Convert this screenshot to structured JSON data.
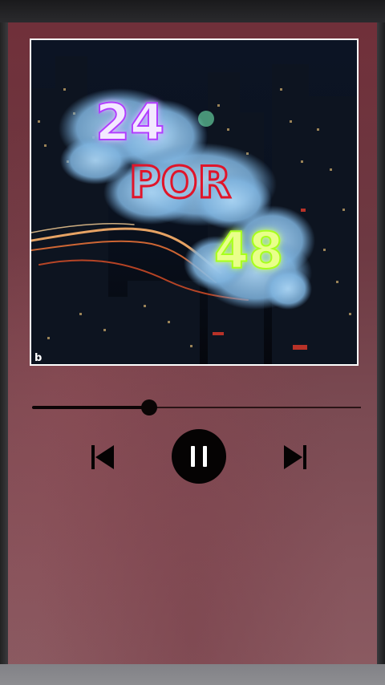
{
  "album_art": {
    "title_top": "24",
    "title_middle": "POR",
    "title_bottom": "48",
    "corner_mark": "b"
  },
  "player": {
    "progress_fraction": 0.355,
    "is_playing": true
  },
  "icons": {
    "previous": "skip-previous-icon",
    "play_pause": "pause-icon",
    "next": "skip-next-icon"
  },
  "colors": {
    "background": "#70303a",
    "accent_dark": "#050303",
    "number_24": "#f3e9ff",
    "number_24_glow": "#b13cff",
    "por_stroke": "#e0152a",
    "number_48": "#e9ff8a",
    "number_48_glow": "#a8ff1a"
  }
}
